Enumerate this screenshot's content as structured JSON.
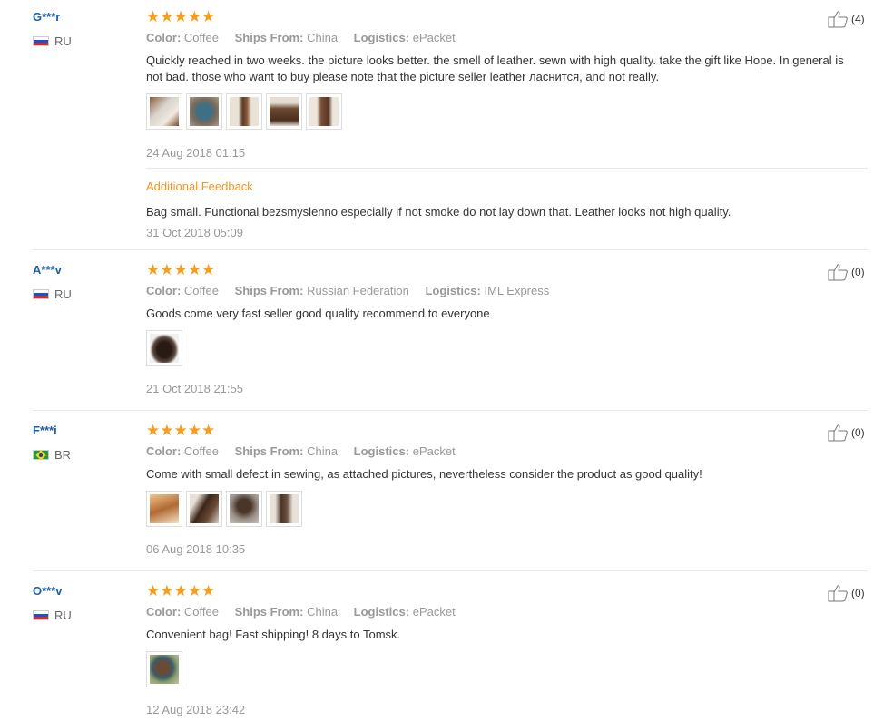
{
  "reviews": [
    {
      "user": "G***r",
      "country": "RU",
      "rating_stars": "★★★★★",
      "color_label": "Color:",
      "color": "Coffee",
      "ships_label": "Ships From:",
      "ships_from": "China",
      "logistics_label": "Logistics:",
      "logistics": "ePacket",
      "text": "Quickly reached in two weeks. the picture looks better. the smell of leather. sewn with high quality. take the gift like Hope. In general is not bad. those who want to buy please note that the picture seller leather ласнится, and not really.",
      "date": "24 Aug 2018 01:15",
      "helpful": "(4)",
      "additional": {
        "title": "Additional Feedback",
        "text": "Bag small. Functional bezsmyslenno especially if not smoke do not lay down that. Leather looks not high quality.",
        "date": "31 Oct 2018 05:09"
      }
    },
    {
      "user": "A***v",
      "country": "RU",
      "rating_stars": "★★★★★",
      "color_label": "Color:",
      "color": "Coffee",
      "ships_label": "Ships From:",
      "ships_from": "Russian Federation",
      "logistics_label": "Logistics:",
      "logistics": "IML Express",
      "text": "Goods come very fast seller good quality recommend to everyone",
      "date": "21 Oct 2018 21:55",
      "helpful": "(0)"
    },
    {
      "user": "F***i",
      "country": "BR",
      "rating_stars": "★★★★★",
      "color_label": "Color:",
      "color": "Coffee",
      "ships_label": "Ships From:",
      "ships_from": "China",
      "logistics_label": "Logistics:",
      "logistics": "ePacket",
      "text": "Come with small defect in sewing, as attached pictures, nevertheless consider the product as good quality!",
      "date": "06 Aug 2018 10:35",
      "helpful": "(0)"
    },
    {
      "user": "O***v",
      "country": "RU",
      "rating_stars": "★★★★★",
      "color_label": "Color:",
      "color": "Coffee",
      "ships_label": "Ships From:",
      "ships_from": "China",
      "logistics_label": "Logistics:",
      "logistics": "ePacket",
      "text": "Convenient bag! Fast shipping! 8 days to Tomsk.",
      "date": "12 Aug 2018 23:42",
      "helpful": "(0)"
    }
  ],
  "colors": {
    "username": "#1d5fa8",
    "star": "#f89c1c",
    "additional_title": "#f7941d",
    "muted": "#999999"
  }
}
